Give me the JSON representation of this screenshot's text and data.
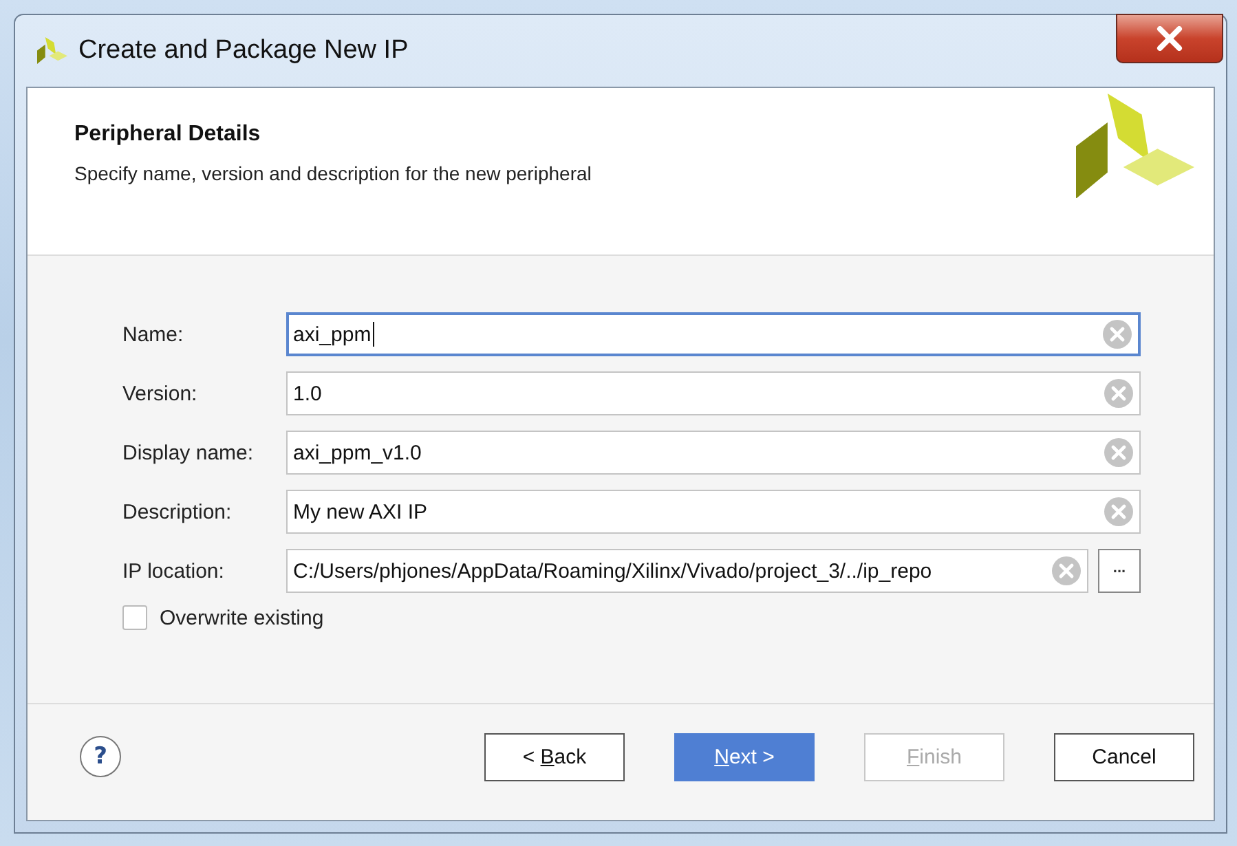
{
  "window": {
    "title": "Create and Package New IP"
  },
  "header": {
    "title": "Peripheral Details",
    "subtitle": "Specify name, version and description for the new peripheral"
  },
  "fields": [
    {
      "label": "Name:",
      "value": "axi_ppm",
      "focused": true,
      "browse": false
    },
    {
      "label": "Version:",
      "value": "1.0",
      "focused": false,
      "browse": false
    },
    {
      "label": "Display name:",
      "value": "axi_ppm_v1.0",
      "focused": false,
      "browse": false
    },
    {
      "label": "Description:",
      "value": "My new AXI IP",
      "focused": false,
      "browse": false
    },
    {
      "label": "IP location:",
      "value": "C:/Users/phjones/AppData/Roaming/Xilinx/Vivado/project_3/../ip_repo",
      "focused": false,
      "browse": true,
      "browse_label": "..."
    }
  ],
  "checkbox": {
    "label": "Overwrite existing",
    "checked": false
  },
  "help": {
    "label": "?"
  },
  "buttons": [
    {
      "before": "< ",
      "mnemonic": "B",
      "after": "ack",
      "kind": "normal",
      "disabled": false
    },
    {
      "mnemonic": "N",
      "after": "ext >",
      "kind": "default",
      "disabled": false
    },
    {
      "mnemonic": "F",
      "after": "inish",
      "kind": "normal",
      "disabled": true
    },
    {
      "after": "Cancel",
      "kind": "normal",
      "disabled": false
    }
  ]
}
